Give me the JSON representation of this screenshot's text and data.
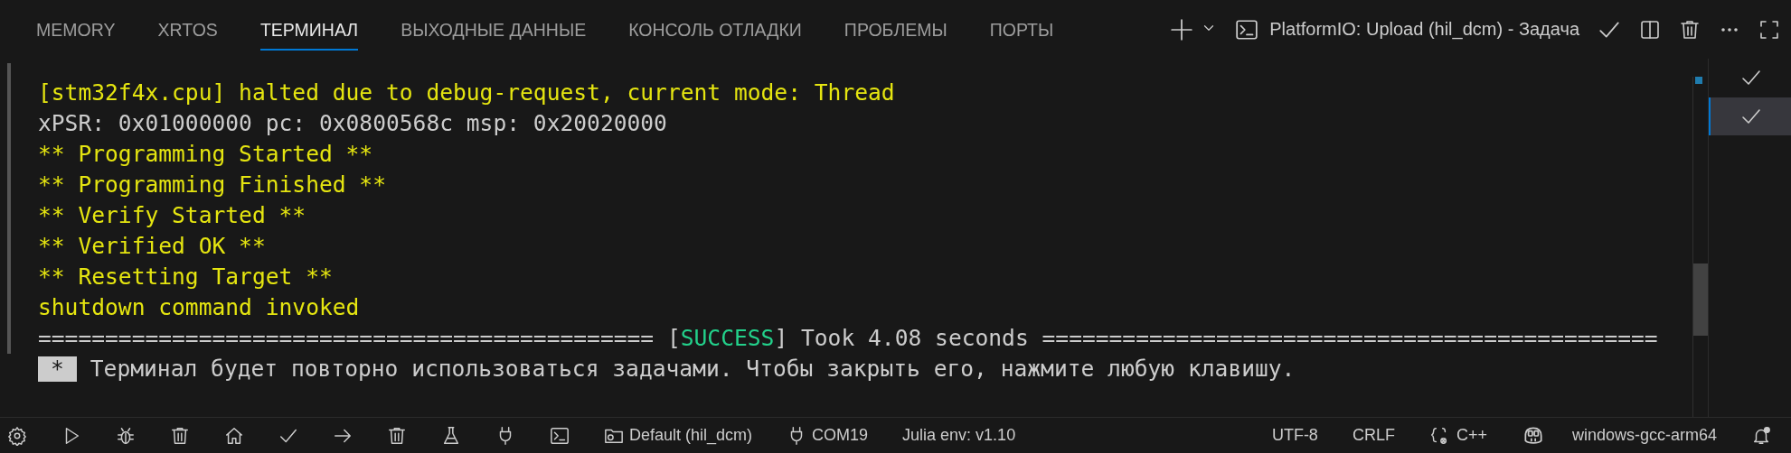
{
  "tabs": [
    {
      "label": "MEMORY",
      "selected": false
    },
    {
      "label": "XRTOS",
      "selected": false
    },
    {
      "label": "ТЕРМИНАЛ",
      "selected": true
    },
    {
      "label": "ВЫХОДНЫЕ ДАННЫЕ",
      "selected": false
    },
    {
      "label": "КОНСОЛЬ ОТЛАДКИ",
      "selected": false
    },
    {
      "label": "ПРОБЛЕМЫ",
      "selected": false
    },
    {
      "label": "ПОРТЫ",
      "selected": false
    }
  ],
  "terminal_title": "PlatformIO: Upload (hil_dcm) - Задача",
  "lines": [
    {
      "text": "[stm32f4x.cpu] halted due to debug-request, current mode: Thread",
      "color": "#e5e510"
    },
    {
      "text": "xPSR: 0x01000000 pc: 0x0800568c msp: 0x20020000",
      "color": "#cccccc"
    },
    {
      "text": "** Programming Started **",
      "color": "#e5e510"
    },
    {
      "text": "** Programming Finished **",
      "color": "#e5e510"
    },
    {
      "text": "** Verify Started **",
      "color": "#e5e510"
    },
    {
      "text": "** Verified OK **",
      "color": "#e5e510"
    },
    {
      "text": "** Resetting Target **",
      "color": "#e5e510"
    },
    {
      "text": "shutdown command invoked",
      "color": "#e5e510"
    }
  ],
  "summary": {
    "before": "============================================== [",
    "status": "SUCCESS",
    "after": "] Took 4.08 seconds =============================================="
  },
  "prompt": {
    "badge": "*",
    "text": "Терминал будет повторно использоваться задачами. Чтобы закрыть его, нажмите любую клавишу."
  },
  "terminals": [
    {
      "selected": false
    },
    {
      "selected": true
    }
  ],
  "status_bar": {
    "profile": "Default (hil_dcm)",
    "port": "COM19",
    "julia": "Julia env: v1.10",
    "encoding": "UTF-8",
    "eol": "CRLF",
    "language": "C++",
    "toolchain": "windows-gcc-arm64"
  }
}
